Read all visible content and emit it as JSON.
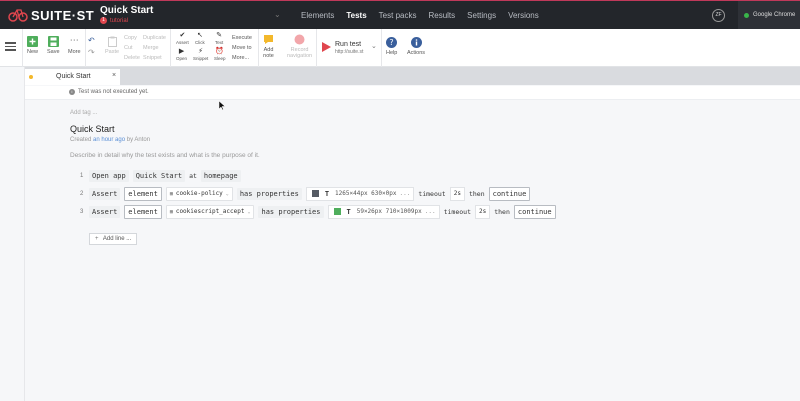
{
  "brand": {
    "logo_text": "SUITE·ST"
  },
  "project": {
    "name": "Quick Start",
    "badge_number": "1",
    "badge_label": "tutorial"
  },
  "nav": {
    "items": [
      "Elements",
      "Tests",
      "Test packs",
      "Results",
      "Settings",
      "Versions"
    ],
    "active": "Tests"
  },
  "user": {
    "initials": "ZF"
  },
  "device": {
    "label": "Google Chrome"
  },
  "toolbar": {
    "new": "New",
    "save": "Save",
    "more": "More",
    "paste": "Paste",
    "copy": "Copy",
    "cut": "Cut",
    "delete": "Delete",
    "duplicate": "Duplicate",
    "merge": "Merge",
    "snippet": "Snippet",
    "assert": "Assert",
    "click": "Click",
    "text": "Text",
    "open": "Open",
    "snippet2": "Snippet",
    "sleep": "Sleep",
    "execute": "Execute",
    "move_to": "Move to",
    "more2": "More...",
    "add_note_1": "Add",
    "add_note_2": "note",
    "record_1": "Record",
    "record_2": "navigation",
    "run_test": "Run test",
    "run_url": "http://suite.st",
    "help": "Help",
    "actions": "Actions"
  },
  "tab": {
    "label": "Quick Start",
    "close": "×"
  },
  "info": {
    "icon": "i",
    "text": "Test was not executed yet."
  },
  "test": {
    "add_tag": "Add tag ...",
    "title": "Quick Start",
    "created_pre": "Created",
    "created_time": "an hour ago",
    "created_post": "by Anton",
    "description": "Describe in detail why the test exists and what is the purpose of it."
  },
  "lines": [
    {
      "num": "1",
      "cmd": "Open app",
      "arg": "Quick Start",
      "mid": "at",
      "target": "homepage"
    },
    {
      "num": "2",
      "cmd": "Assert",
      "kind": "element",
      "selector": "cookie-policy",
      "verb": "has properties",
      "swatch": "#555a63",
      "props": "1265×44px  630×0px",
      "more": "...",
      "timeout_label": "timeout",
      "timeout": "2s",
      "then": "then",
      "action": "continue"
    },
    {
      "num": "3",
      "cmd": "Assert",
      "kind": "element",
      "selector": "cookiescript_accept",
      "verb": "has properties",
      "swatch": "#4fae5c",
      "props": "59×26px  710×1009px",
      "more": "...",
      "timeout_label": "timeout",
      "timeout": "2s",
      "then": "then",
      "action": "continue"
    }
  ],
  "add_line": {
    "plus": "+",
    "label": "Add line ..."
  },
  "colors": {
    "topbar": "#23262b",
    "accent": "#e0464e",
    "note": "#f3b82b",
    "run": "#e0464e",
    "help": "#3a5f9c"
  }
}
